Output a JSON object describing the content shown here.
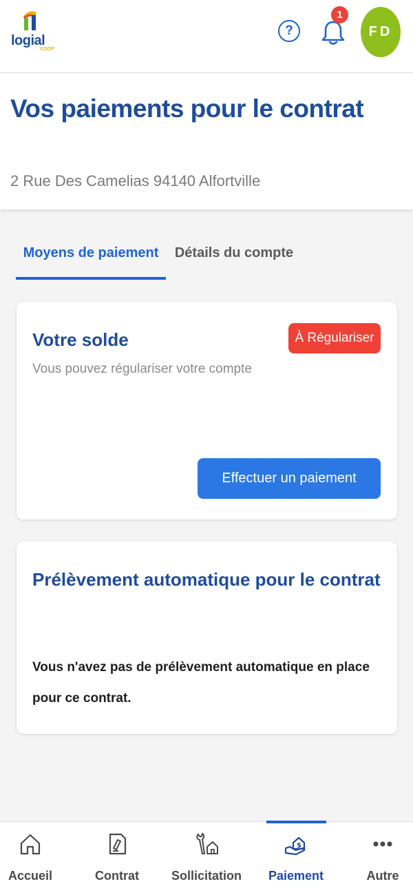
{
  "header": {
    "logo_text": "logial",
    "logo_sub": "COOP",
    "help_label": "?",
    "notification_count": "1",
    "avatar_initials": "FD"
  },
  "page": {
    "title": "Vos paiements pour le contrat",
    "address": "2 Rue Des Camelias 94140 Alfortville"
  },
  "tabs": [
    {
      "label": "Moyens de paiement",
      "active": true
    },
    {
      "label": "Détails du compte",
      "active": false
    }
  ],
  "balance_card": {
    "title": "Votre solde",
    "subtitle": "Vous pouvez régulariser votre compte",
    "status": "À Régulariser",
    "button_label": "Effectuer un paiement"
  },
  "debit_card": {
    "title": "Prélèvement automatique pour le contrat",
    "text": "Vous n'avez pas de prélèvement automatique en place pour ce contrat."
  },
  "bottom_nav": [
    {
      "label": "Accueil",
      "icon": "home-icon"
    },
    {
      "label": "Contrat",
      "icon": "contract-icon"
    },
    {
      "label": "Sollicitation",
      "icon": "request-icon"
    },
    {
      "label": "Paiement",
      "icon": "payment-icon",
      "active": true
    },
    {
      "label": "Autre",
      "icon": "more-icon"
    }
  ],
  "colors": {
    "brand_blue": "#1f4c9b",
    "accent_blue": "#1f63d6",
    "button_blue": "#2b78e4",
    "alert_red": "#ef4136",
    "avatar_green": "#8fbf1c"
  }
}
